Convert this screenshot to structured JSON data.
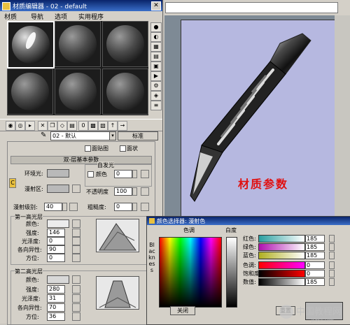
{
  "window": {
    "title": "材质编辑器 - 02 - default"
  },
  "menu": {
    "items": [
      "材质",
      "导航",
      "选项",
      "实用程序"
    ]
  },
  "material": {
    "name": "02 - 默认",
    "type_button": "标准"
  },
  "panel": {
    "map_options": [
      "面贴图",
      "面状"
    ],
    "rollout_title": "双-层基本参数",
    "ambient_label": "环境光:",
    "diffuse_label": "漫射区:",
    "self_illum_group": "自发光",
    "color_label": "颜色",
    "color_value": "0",
    "opacity_label": "不透明度",
    "opacity_value": "100",
    "diffuse_level_label": "漫射级别:",
    "diffuse_level_value": "40",
    "roughness_label": "粗糙度:",
    "roughness_value": "0",
    "lock_c": "C",
    "spec1": {
      "group": "第一高光层",
      "color": "颜色:",
      "level": "强度:",
      "level_value": "146",
      "gloss": "光泽度:",
      "gloss_value": "0",
      "aniso": "各向异性:",
      "aniso_value": "90",
      "orient": "方位:",
      "orient_value": "0"
    },
    "spec2": {
      "group": "第二高光层",
      "color": "颜色:",
      "level": "强度:",
      "level_value": "280",
      "gloss": "光泽度:",
      "gloss_value": "31",
      "aniso": "各向异性:",
      "aniso_value": "70",
      "orient": "方位:",
      "orient_value": "36"
    }
  },
  "viewport": {
    "overlay_text": "材质参数"
  },
  "color_selector": {
    "title": "颜色选择器: 漫射色",
    "hue_label": "色调",
    "whiteness_label": "白度",
    "blackness_label": "Blackness",
    "channels": [
      {
        "name": "红色:",
        "value": "185",
        "from": "#2a9fa0",
        "to": "#ffffff"
      },
      {
        "name": "绿色:",
        "value": "185",
        "from": "#b010b0",
        "to": "#ffffff"
      },
      {
        "name": "蓝色:",
        "value": "185",
        "from": "#b0b020",
        "to": "#ffffff"
      },
      {
        "name": "色调:",
        "value": "0",
        "from": "#ff0000",
        "to": "#ff00ff"
      },
      {
        "name": "饱和度:",
        "value": "0",
        "from": "#000000",
        "to": "#ff0000"
      },
      {
        "name": "数值:",
        "value": "185",
        "from": "#000000",
        "to": "#ffffff"
      }
    ],
    "close_button": "关闭",
    "reset_button": "重置",
    "preview_color": "#b9b9b9"
  },
  "watermark": {
    "text": "中国教程网",
    "sub": "jcwcn.com"
  }
}
